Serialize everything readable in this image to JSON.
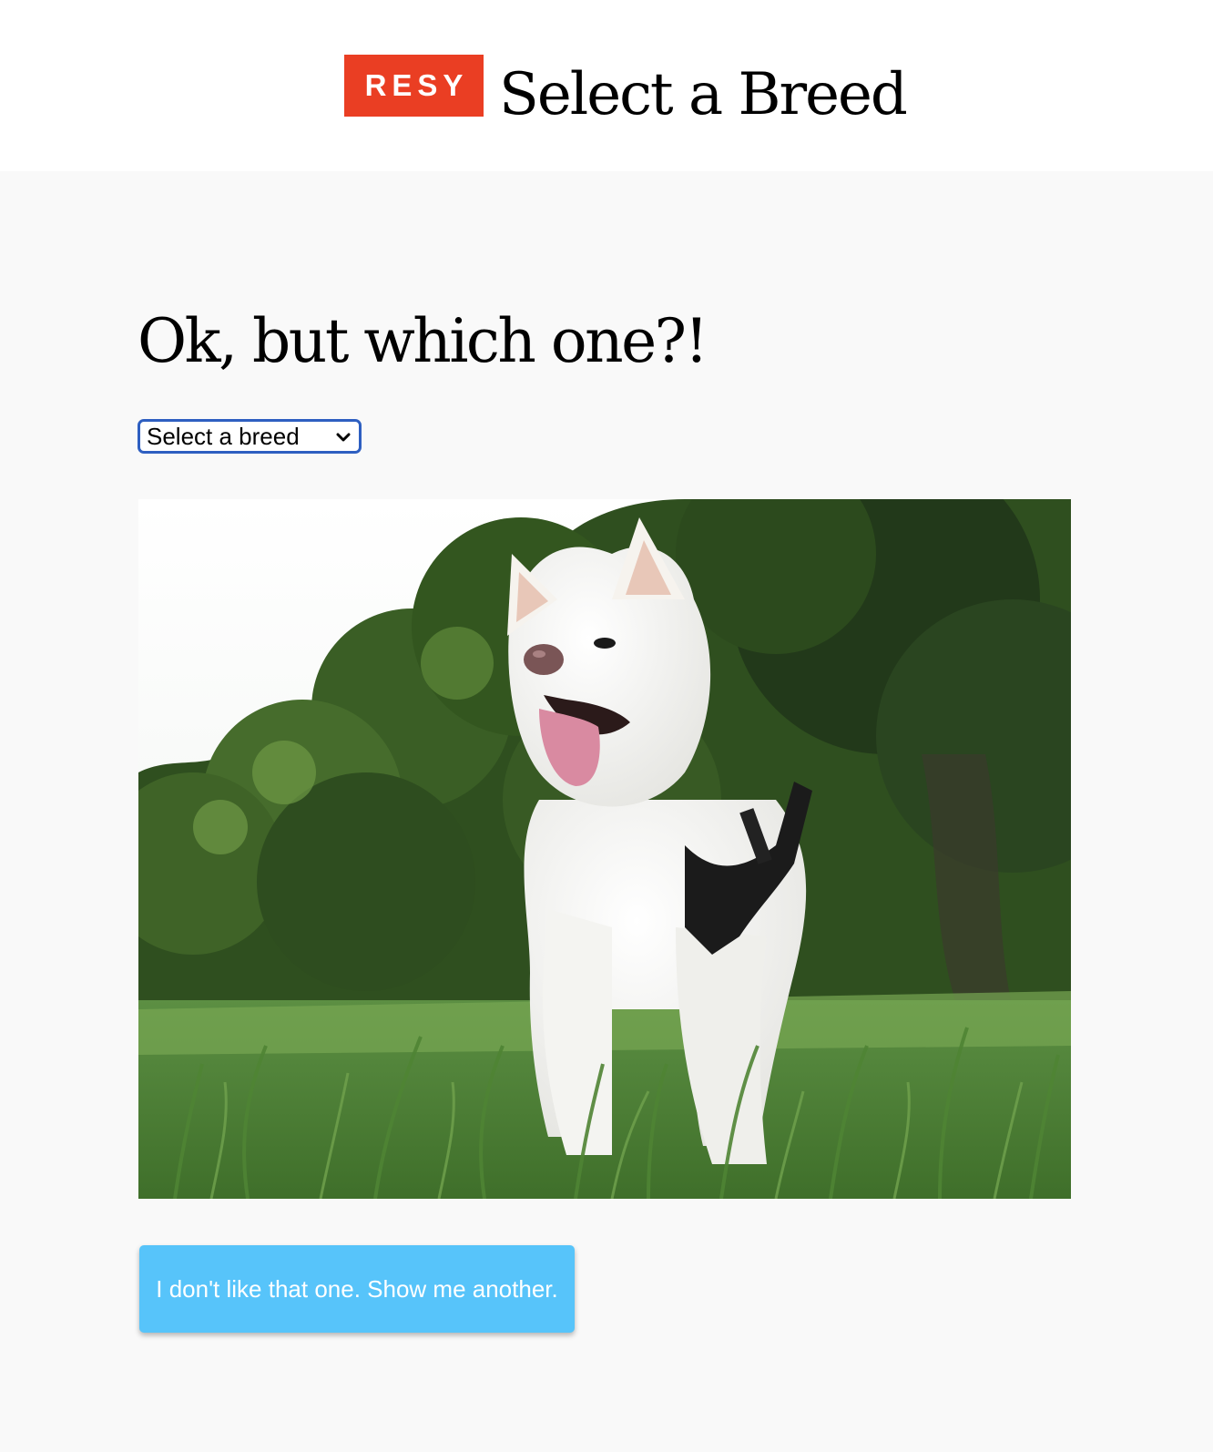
{
  "header": {
    "logo_text": "RESY",
    "title": "Select a Breed"
  },
  "main": {
    "heading": "Ok, but which one?!",
    "breed_select": {
      "selected": "Select a breed"
    },
    "dog_image": {
      "subject": "white dog in harness standing in tall grass"
    },
    "another_button_label": "I don't like that one. Show me another."
  },
  "colors": {
    "brand_red": "#ea3e23",
    "button_blue": "#57c4fa",
    "select_focus_border": "#2e5fc1",
    "page_background": "#f9f9f9"
  }
}
